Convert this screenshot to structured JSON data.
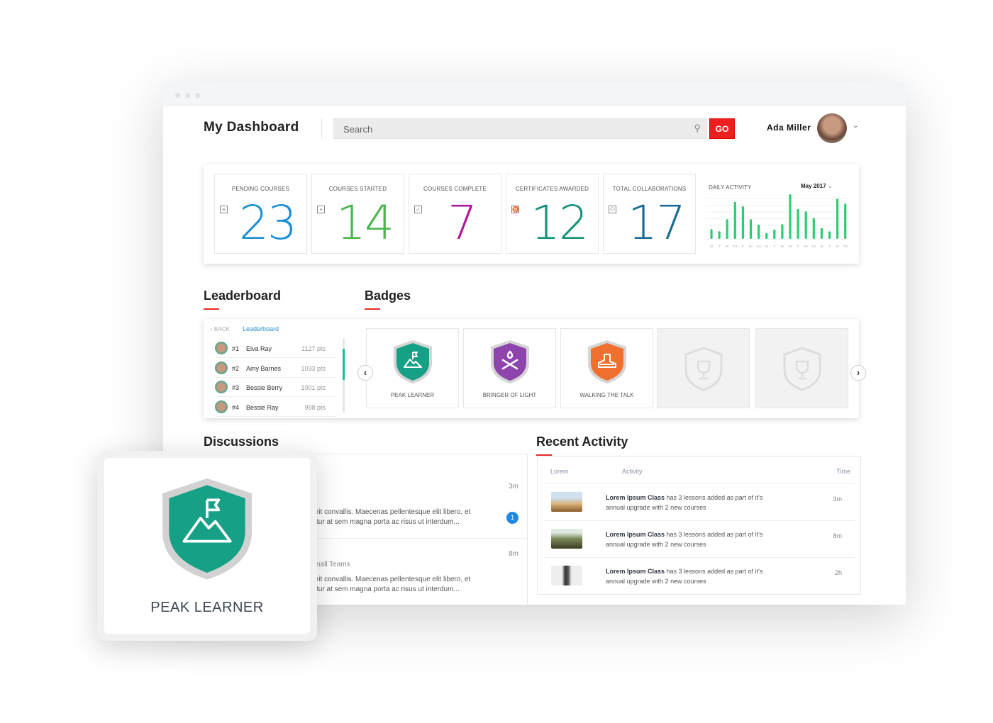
{
  "header": {
    "title": "My Dashboard",
    "search_placeholder": "Search",
    "go_label": "GO",
    "user_name": "Ada Miller"
  },
  "stats": [
    {
      "label": "PENDING COURSES",
      "value": "23",
      "color": "#1a8fd6",
      "icon": "list-icon"
    },
    {
      "label": "COURSES STARTED",
      "value": "14",
      "color": "#4cb54f",
      "icon": "calendar-plus-icon"
    },
    {
      "label": "COURSES COMPLETE",
      "value": "7",
      "color": "#b2169e",
      "icon": "calendar-check-icon"
    },
    {
      "label": "CERTIFICATES AWARDED",
      "value": "12",
      "color": "#14937a",
      "icon": "medal-icon"
    },
    {
      "label": "TOTAL COLLABORATIONS",
      "value": "17",
      "color": "#1a6b96",
      "icon": "users-icon"
    }
  ],
  "daily_activity": {
    "label": "DAILY ACTIVITY",
    "month": "May 2017"
  },
  "chart_data": {
    "type": "bar",
    "title": "DAILY ACTIVITY",
    "categories": [
      "M",
      "T",
      "W",
      "TH",
      "F",
      "SA",
      "SU",
      "M",
      "T",
      "W",
      "TH",
      "F",
      "SA",
      "SU",
      "M",
      "T",
      "W",
      "TH"
    ],
    "values": [
      22,
      17,
      44,
      83,
      73,
      44,
      32,
      13,
      21,
      33,
      100,
      67,
      62,
      47,
      24,
      17,
      90,
      79
    ],
    "color": "#2ecc71",
    "grid": true
  },
  "leaderboard": {
    "title": "Leaderboard",
    "back": "BACK",
    "crumb": "Leaderboard",
    "rows": [
      {
        "rank": "#1",
        "name": "Elva Ray",
        "pts": "1127 pts"
      },
      {
        "rank": "#2",
        "name": "Amy Barnes",
        "pts": "1033 pts"
      },
      {
        "rank": "#3",
        "name": "Bessie Berry",
        "pts": "1001 pts"
      },
      {
        "rank": "#4",
        "name": "Bessie Ray",
        "pts": "998 pts"
      }
    ]
  },
  "badges": {
    "title": "Badges",
    "items": [
      {
        "label": "PEAK LEARNER",
        "color": "#16a085",
        "icon": "mountain-flag-icon"
      },
      {
        "label": "BRINGER OF LIGHT",
        "color": "#8e44ad",
        "icon": "campfire-icon"
      },
      {
        "label": "WALKING THE TALK",
        "color": "#f07030",
        "icon": "sneaker-icon"
      }
    ]
  },
  "discussions": {
    "title": "Discussions",
    "items": [
      {
        "time": "3m",
        "line1": "rit convallis. Maecenas pellentesque elit libero, et",
        "line2": "tur at sem magna porta ac risus ut interdum...",
        "badge": "1"
      },
      {
        "time": "8m",
        "sub": "nall Teams",
        "line1": "rit convallis. Maecenas pellentesque elit libero, et",
        "line2": "tur at sem magna porta ac risus ut interdum..."
      }
    ]
  },
  "recent": {
    "title": "Recent Activity",
    "cols": [
      "Lorem",
      "Activity",
      "Time"
    ],
    "rows": [
      {
        "bold": "Lorem Ipsum Class",
        "text": " has 3 lessons added as part of it's",
        "line2": "annual upgrade with 2 new courses",
        "time": "3m"
      },
      {
        "bold": "Lorem Ipsum Class",
        "text": " has 3 lessons added as part of it's",
        "line2": "annual upgrade with 2 new courses",
        "time": "8m"
      },
      {
        "bold": "Lorem Ipsum Class",
        "text": " has 3 lessons added as part of it's",
        "line2": "annual upgrade with 2 new courses",
        "time": "2h"
      }
    ]
  },
  "featured_badge": {
    "label": "PEAK LEARNER",
    "color": "#16a085"
  }
}
